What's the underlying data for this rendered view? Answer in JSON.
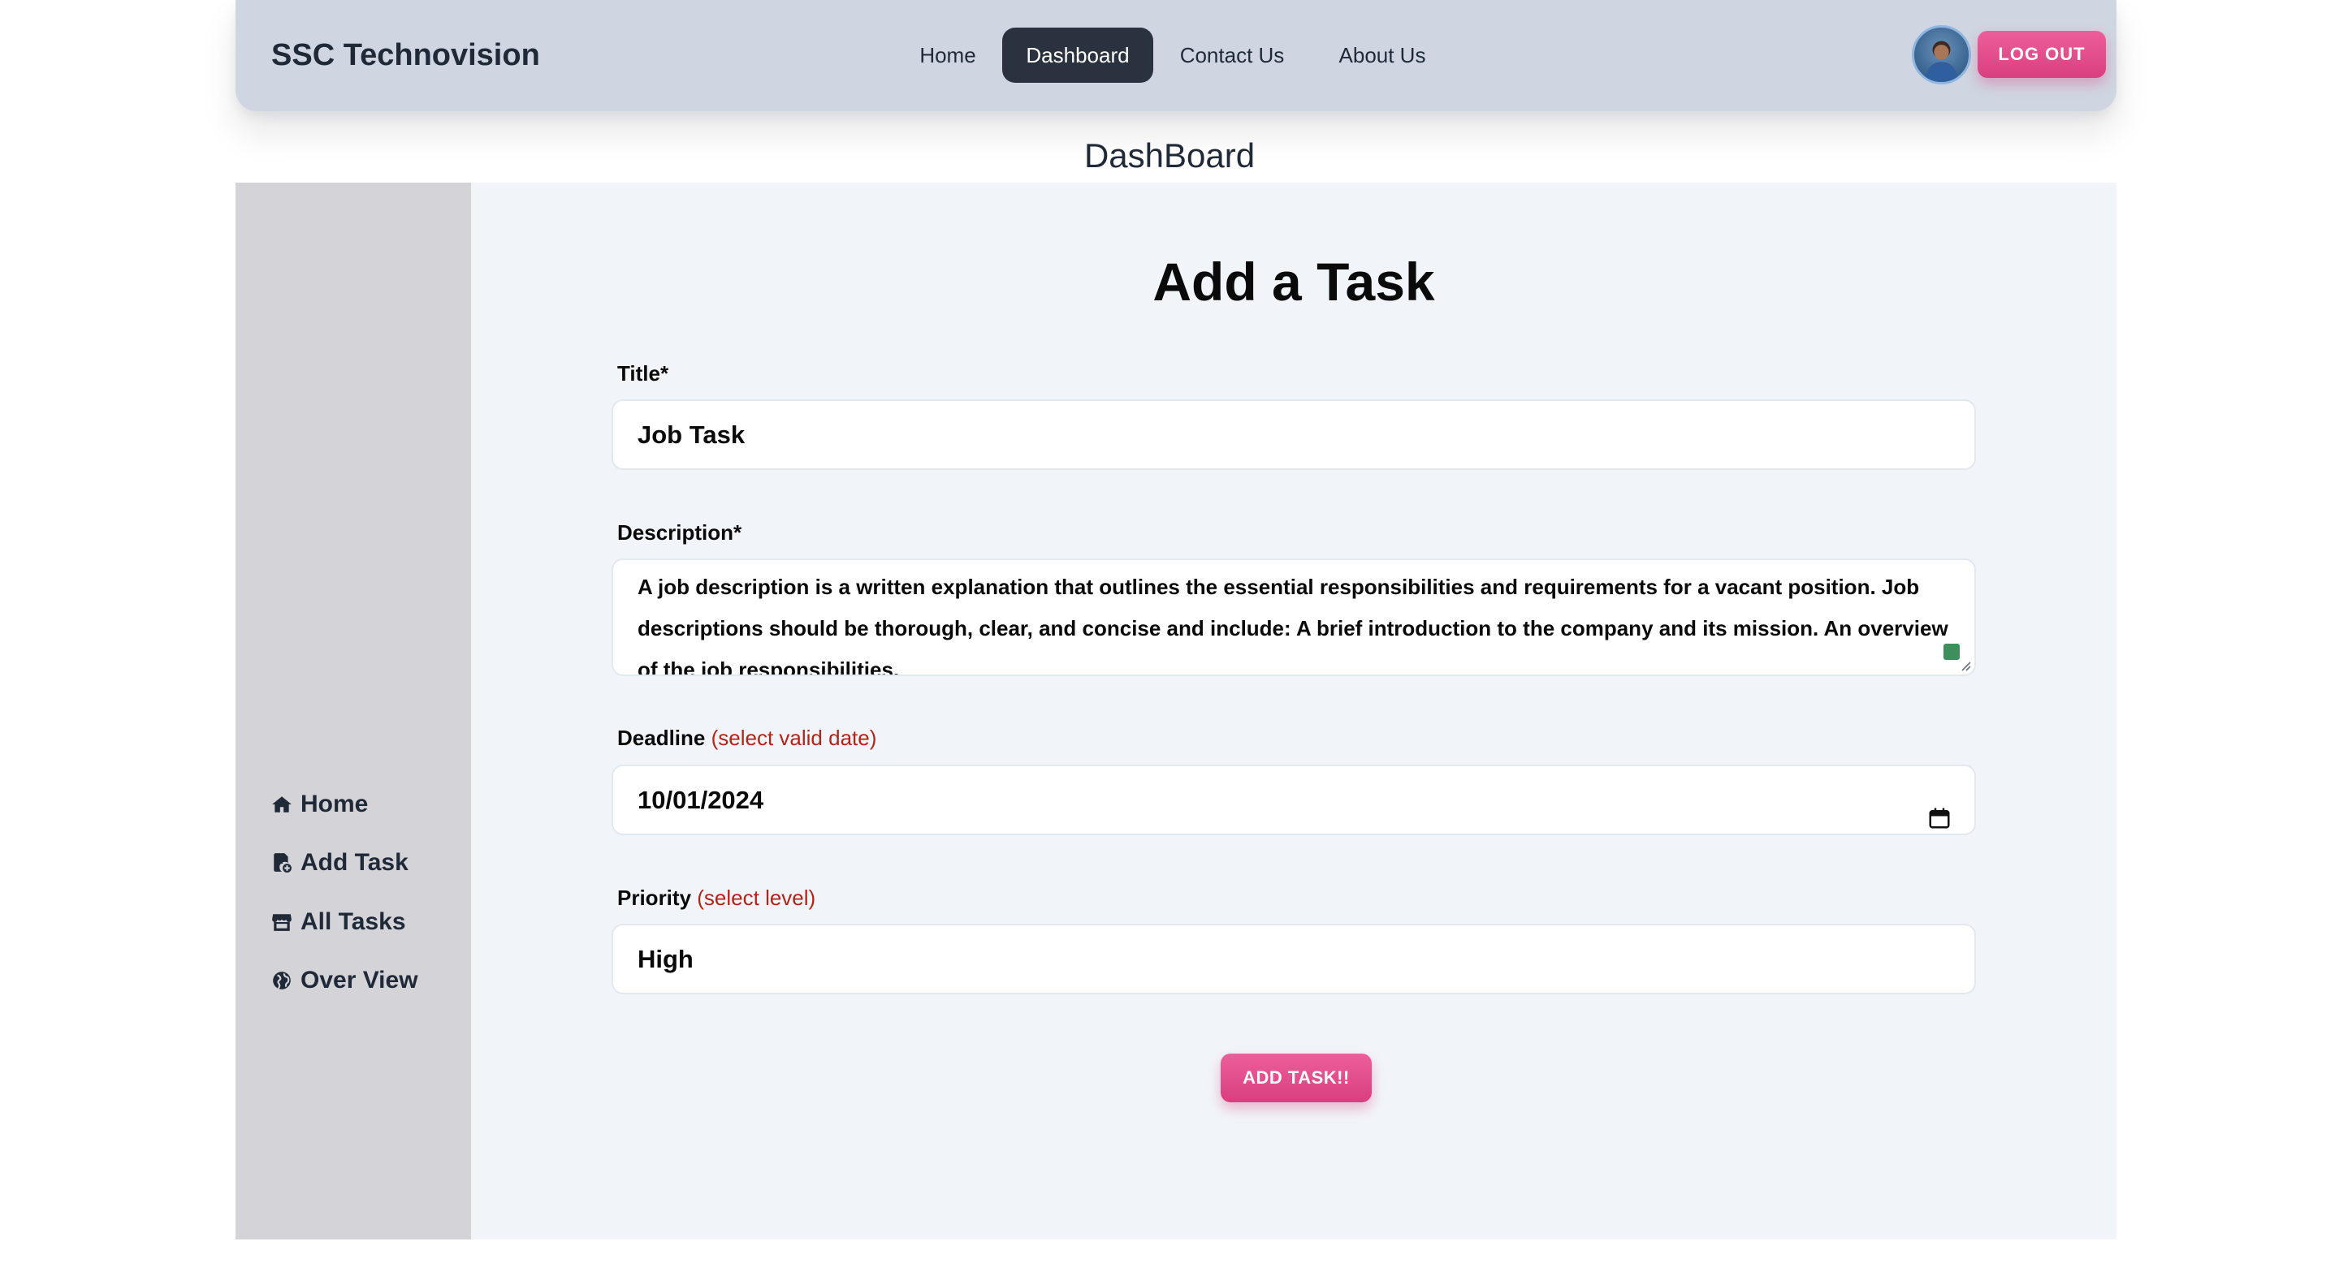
{
  "navbar": {
    "brand": "SSC Technovision",
    "links": [
      {
        "label": "Home",
        "active": false
      },
      {
        "label": "Dashboard",
        "active": true
      },
      {
        "label": "Contact Us",
        "active": false
      },
      {
        "label": "About Us",
        "active": false
      }
    ],
    "logout_label": "LOG OUT"
  },
  "page": {
    "title": "DashBoard"
  },
  "sidebar": {
    "items": [
      {
        "label": "Home",
        "icon": "home-icon"
      },
      {
        "label": "Add Task",
        "icon": "add-task-icon"
      },
      {
        "label": "All Tasks",
        "icon": "store-icon"
      },
      {
        "label": "Over View",
        "icon": "globe-icon"
      }
    ]
  },
  "form": {
    "title": "Add a Task",
    "title_field": {
      "label": "Title*",
      "value": "Job Task"
    },
    "description_field": {
      "label": "Description*",
      "value": "A job description is a written explanation that outlines the essential responsibilities and requirements for a vacant position. Job descriptions should be thorough, clear, and concise and include: A brief introduction to the company and its mission. An overview of the job responsibilities."
    },
    "deadline_field": {
      "label": "Deadline",
      "hint": "(select valid date)",
      "value": "10/01/2024"
    },
    "priority_field": {
      "label": "Priority",
      "hint": "(select level)",
      "value": "High"
    },
    "submit_label": "ADD TASK!!"
  },
  "colors": {
    "navbar_bg": "#cfd6e1",
    "active_nav": "#2b323f",
    "accent_pink": "#e14d8b",
    "sidebar_bg": "#d4d4d8",
    "main_bg": "#f1f5f9",
    "hint_red": "#b42318"
  }
}
